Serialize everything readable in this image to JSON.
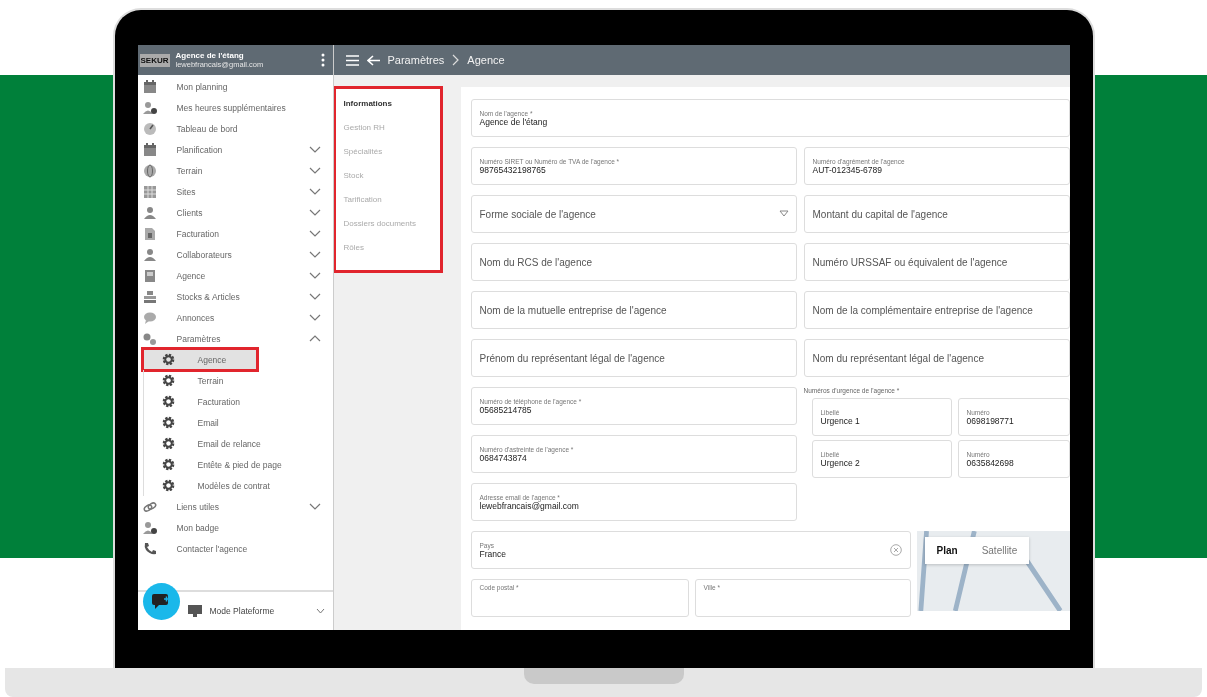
{
  "sidebar": {
    "logo": "SEKUR",
    "agency": "Agence de l'étang",
    "email": "lewebfrancais@gmail.com",
    "items": [
      {
        "label": "Mon planning",
        "kind": "calendar"
      },
      {
        "label": "Mes heures supplémentaires",
        "kind": "person-clock"
      },
      {
        "label": "Tableau de bord",
        "kind": "gauge"
      },
      {
        "label": "Planification",
        "kind": "calendar",
        "expanded": false
      },
      {
        "label": "Terrain",
        "kind": "globe",
        "expanded": false
      },
      {
        "label": "Sites",
        "kind": "building",
        "expanded": false
      },
      {
        "label": "Clients",
        "kind": "person",
        "expanded": false
      },
      {
        "label": "Facturation",
        "kind": "document",
        "expanded": false
      },
      {
        "label": "Collaborateurs",
        "kind": "person",
        "expanded": false
      },
      {
        "label": "Agence",
        "kind": "id-card",
        "expanded": false
      },
      {
        "label": "Stocks & Articles",
        "kind": "boxes",
        "expanded": false
      },
      {
        "label": "Annonces",
        "kind": "chat",
        "expanded": false
      },
      {
        "label": "Paramètres",
        "kind": "gears",
        "expanded": true,
        "children": [
          {
            "label": "Agence",
            "kind": "gear",
            "selected": true,
            "highlighted": true
          },
          {
            "label": "Terrain",
            "kind": "gear",
            "selected": false,
            "highlighted": false
          },
          {
            "label": "Facturation",
            "kind": "gear",
            "selected": false,
            "highlighted": false
          },
          {
            "label": "Email",
            "kind": "gear",
            "selected": false,
            "highlighted": false
          },
          {
            "label": "Email de relance",
            "kind": "gear",
            "selected": false,
            "highlighted": false
          },
          {
            "label": "Entête & pied de page",
            "kind": "gear",
            "selected": false,
            "highlighted": false
          },
          {
            "label": "Modèles de contrat",
            "kind": "gear",
            "selected": false,
            "highlighted": false
          }
        ]
      },
      {
        "label": "Liens utiles",
        "kind": "link",
        "expanded": false
      },
      {
        "label": "Mon badge",
        "kind": "person-clock"
      },
      {
        "label": "Contacter l'agence",
        "kind": "phone"
      }
    ],
    "mode": "Mode Plateforme"
  },
  "topbar": {
    "breadcrumb": [
      "Paramètres",
      "Agence"
    ]
  },
  "sections": {
    "highlighted": true,
    "items": [
      {
        "label": "Informations",
        "selected": true
      },
      {
        "label": "Gestion RH",
        "selected": false
      },
      {
        "label": "Spécialités",
        "selected": false
      },
      {
        "label": "Stock",
        "selected": false
      },
      {
        "label": "Tarification",
        "selected": false
      },
      {
        "label": "Dossiers documents",
        "selected": false
      },
      {
        "label": "Rôles",
        "selected": false
      }
    ]
  },
  "form": {
    "rows": [
      [
        {
          "kind": "text",
          "label": "Nom de l'agence *",
          "value": "Agence de l'étang"
        }
      ],
      [
        {
          "kind": "text",
          "label": "Numéro SIRET ou Numéro de TVA de l'agence *",
          "value": "98765432198765"
        },
        {
          "kind": "text",
          "label": "Numéro d'agrément de l'agence",
          "value": "AUT-012345-6789"
        }
      ],
      [
        {
          "kind": "select",
          "placeholder": "Forme sociale de l'agence"
        },
        {
          "kind": "empty",
          "placeholder": "Montant du capital de l'agence"
        }
      ],
      [
        {
          "kind": "empty",
          "placeholder": "Nom du RCS de l'agence"
        },
        {
          "kind": "empty",
          "placeholder": "Numéro URSSAF ou équivalent de l'agence"
        }
      ],
      [
        {
          "kind": "empty",
          "placeholder": "Nom de la mutuelle entreprise de l'agence"
        },
        {
          "kind": "empty",
          "placeholder": "Nom de la complémentaire entreprise de l'agence"
        }
      ],
      [
        {
          "kind": "empty",
          "placeholder": "Prénom du représentant légal de l'agence"
        },
        {
          "kind": "empty",
          "placeholder": "Nom du représentant légal de l'agence"
        }
      ]
    ],
    "contacts": [
      {
        "kind": "text",
        "label": "Numéro de téléphone de l'agence *",
        "value": "05685214785"
      },
      {
        "kind": "text",
        "label": "Numéro d'astreinte de l'agence *",
        "value": "0684743874"
      },
      {
        "kind": "text",
        "label": "Adresse email de l'agence *",
        "value": "lewebfrancais@gmail.com"
      }
    ],
    "emergency": {
      "label": "Numéros d'urgence de l'agence *",
      "entries": [
        {
          "name_label": "Libellé",
          "name": "Urgence 1",
          "number_label": "Numéro",
          "number": "0698198771"
        },
        {
          "name_label": "Libellé",
          "name": "Urgence 2",
          "number_label": "Numéro",
          "number": "0635842698"
        }
      ]
    },
    "country": {
      "kind": "clearable",
      "label": "Pays",
      "value": "France"
    },
    "map": {
      "buttons": [
        {
          "label": "Plan",
          "selected": true
        },
        {
          "label": "Satellite",
          "selected": false
        }
      ]
    },
    "bottom_fields": [
      {
        "kind": "label-only",
        "label": "Code postal *"
      },
      {
        "kind": "label-only",
        "label": "Ville *"
      }
    ]
  }
}
